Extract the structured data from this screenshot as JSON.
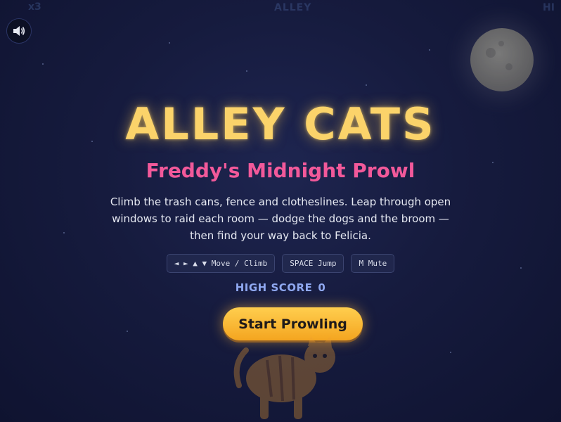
{
  "hud": {
    "left_text": "x3",
    "center_text": "ALLEY",
    "right_text": "HI"
  },
  "sound": {
    "icon": "speaker-icon"
  },
  "title": "ALLEY CATS",
  "subtitle": "Freddy's Midnight Prowl",
  "description": "Climb the trash cans, fence and clotheslines. Leap through open windows to raid each room — dodge the dogs and the broom — then find your way back to Felicia.",
  "controls": [
    {
      "label": "◄ ► ▲ ▼ Move / Climb"
    },
    {
      "label": "SPACE Jump"
    },
    {
      "label": "M Mute"
    }
  ],
  "high_score": {
    "label": "HIGH SCORE",
    "value": "0"
  },
  "start_button": {
    "label": "Start Prowling"
  },
  "colors": {
    "title": "#fbd36a",
    "subtitle": "#f2599a",
    "accent_button": "#f8b834",
    "high_score": "#8fa8f0",
    "background": "#161b3e"
  }
}
